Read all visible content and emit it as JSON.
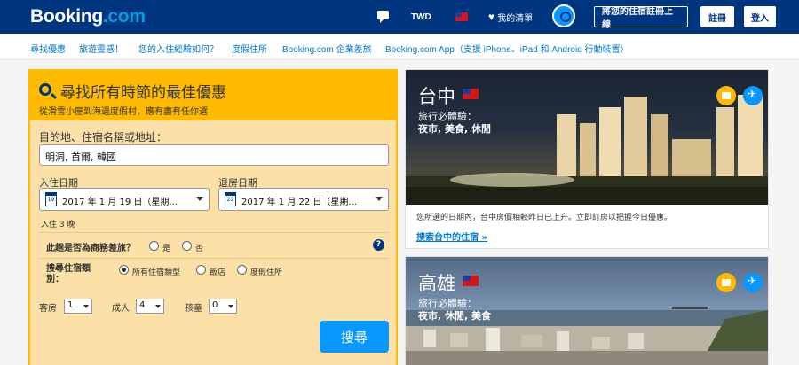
{
  "header": {
    "logo_main": "Booking",
    "logo_dot": ".com",
    "currency": "TWD",
    "wishlist": "我的清單",
    "list_property": "將您的住宿註冊上線",
    "register": "註冊",
    "login": "登入"
  },
  "nav": {
    "items": [
      "尋找優惠",
      "旅遊靈感！",
      "您的入住經驗如何？",
      "度假住所",
      "Booking.com 企業差旅",
      "Booking.com App（支援 iPhone、iPad 和 Android 行動裝置）"
    ]
  },
  "search": {
    "title": "尋找所有時節的最佳優惠",
    "subtitle": "從滑雪小屋到海邊度假村，應有盡有任你選",
    "destination_label": "目的地、住宿名稱或地址：",
    "destination_value": "明洞, 首爾, 韓國",
    "checkin_label": "入住日期",
    "checkin_day": "19",
    "checkin_value": "2017 年 1 月 19 日（星期...",
    "checkout_label": "退房日期",
    "checkout_day": "22",
    "checkout_value": "2017 年 1 月 22 日（星期...",
    "nights": "入住 3 晚",
    "business_question": "此趟是否為商務差旅？",
    "yes": "是",
    "no": "否",
    "help": "?",
    "type_label": "搜尋住宿類別：",
    "type_all": "所有住宿類型",
    "type_hotel": "飯店",
    "type_holiday": "度假住所",
    "rooms_label": "客房",
    "rooms_value": "1",
    "adults_label": "成人",
    "adults_value": "4",
    "children_label": "孩童",
    "children_value": "0",
    "button": "搜尋"
  },
  "cards": [
    {
      "city": "台中",
      "exp_label": "旅行必體驗：",
      "tags": "夜市, 美食, 休閒",
      "desc": "您所選的日期內，台中房價相較昨日已上升。立即訂房以把握今日優惠。",
      "link": "搜索台中的住宿 »"
    },
    {
      "city": "高雄",
      "exp_label": "旅行必體驗：",
      "tags": "夜市, 休閒, 美食"
    }
  ],
  "colors": {
    "brand_blue": "#003580",
    "accent_yellow": "#febb02",
    "button_blue": "#0896ff",
    "link_blue": "#0077cc"
  }
}
